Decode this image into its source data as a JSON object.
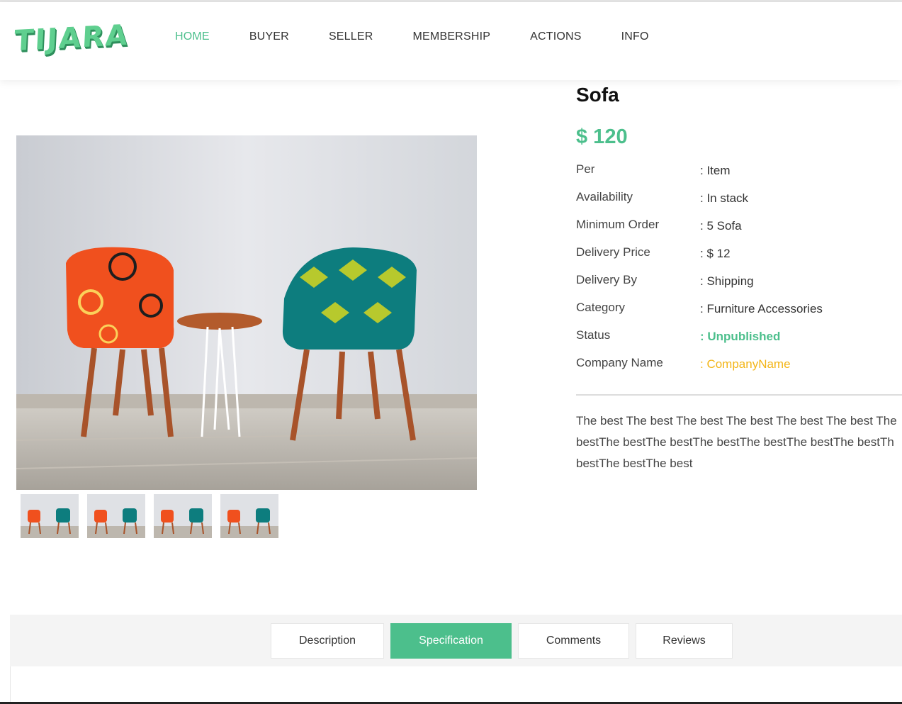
{
  "header": {
    "logo_text": "TIJARA",
    "nav": [
      {
        "label": "HOME",
        "active": true
      },
      {
        "label": "BUYER",
        "active": false
      },
      {
        "label": "SELLER",
        "active": false
      },
      {
        "label": "MEMBERSHIP",
        "active": false
      },
      {
        "label": "ACTIONS",
        "active": false
      },
      {
        "label": "INFO",
        "active": false
      }
    ]
  },
  "product": {
    "title": "Sofa",
    "price": "$ 120",
    "specs": [
      {
        "label": "Per",
        "value": ": Item"
      },
      {
        "label": "Availability",
        "value": ": In stack"
      },
      {
        "label": "Minimum Order",
        "value": ": 5 Sofa"
      },
      {
        "label": "Delivery Price",
        "value": ": $ 12"
      },
      {
        "label": "Delivery By",
        "value": ": Shipping"
      },
      {
        "label": "Category",
        "value": ": Furniture Accessories"
      },
      {
        "label": "Status",
        "value": ": Unpublished"
      },
      {
        "label": "Company Name",
        "value": ": CompanyName"
      }
    ],
    "description_lines": [
      "The best The best The best The best The best The best The",
      "bestThe bestThe bestThe bestThe bestThe bestThe bestTh",
      "bestThe bestThe best"
    ],
    "image_alt": "two patterned chairs with a small round table",
    "thumbnail_count": 4
  },
  "tabs": [
    {
      "label": "Description",
      "active": false
    },
    {
      "label": "Specification",
      "active": true
    },
    {
      "label": "Comments",
      "active": false
    },
    {
      "label": "Reviews",
      "active": false
    }
  ],
  "colors": {
    "accent": "#4cbf8c",
    "company_link": "#f3b517",
    "chair_left": "#f0501e",
    "chair_right": "#0d7d7e"
  }
}
